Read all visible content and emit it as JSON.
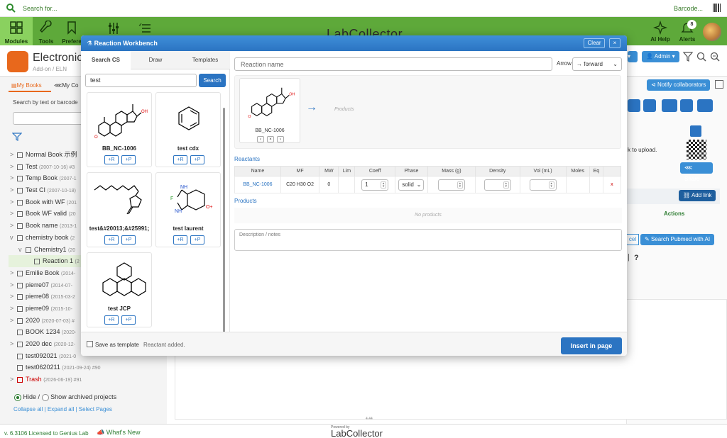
{
  "topbar": {
    "search_placeholder": "Search for...",
    "barcode_label": "Barcode..."
  },
  "nav": {
    "items": [
      {
        "label": "Modules",
        "icon": "grid-icon"
      },
      {
        "label": "Tools",
        "icon": "wrench-icon"
      },
      {
        "label": "Prefere",
        "icon": "bookmark-icon"
      }
    ],
    "logo": "LabCollector",
    "ai_help": "AI Help",
    "alerts": "Alerts",
    "alerts_count": "8"
  },
  "app": {
    "title": "Electronic",
    "subtitle": "Add-on / ELN",
    "admin": "Admin",
    "notify": "Notify collaborators",
    "upload_hint": "k to upload.",
    "share": "Share",
    "add_link": "Add link",
    "actions": "Actions",
    "cel": "cel",
    "pubmed": "Search Pubmed with AI",
    "question": "?"
  },
  "sidebar": {
    "tab_books": "My Books",
    "tab_co": "My Co",
    "search_label": "Search by text or barcode",
    "tree": [
      {
        "caret": ">",
        "name": "Normal Book 示例",
        "date": ""
      },
      {
        "caret": ">",
        "name": "Test",
        "date": "(2007-10-16) #3"
      },
      {
        "caret": ">",
        "name": "Temp Book",
        "date": "(2007-1"
      },
      {
        "caret": ">",
        "name": "Test CI",
        "date": "(2007-10-18)"
      },
      {
        "caret": ">",
        "name": "Book with WF",
        "date": "(201"
      },
      {
        "caret": ">",
        "name": "Book WF valid",
        "date": "(20"
      },
      {
        "caret": ">",
        "name": "Book name",
        "date": "(2013-1"
      },
      {
        "caret": "v",
        "name": "chemistry book",
        "date": "(2"
      },
      {
        "caret": "v",
        "name": "Chemistry1",
        "date": "(20",
        "indent": 1
      },
      {
        "caret": "",
        "name": "Reaction 1",
        "date": "(2",
        "indent": 2,
        "active": true
      },
      {
        "caret": ">",
        "name": "Emilie Book",
        "date": "(2014-"
      },
      {
        "caret": ">",
        "name": "pierre07",
        "date": "(2014-07-"
      },
      {
        "caret": ">",
        "name": "pierre08",
        "date": "(2015-03-2"
      },
      {
        "caret": ">",
        "name": "pierre09",
        "date": "(2015-10-"
      },
      {
        "caret": ">",
        "name": "2020",
        "date": "(2020-07-03) #"
      },
      {
        "caret": "",
        "name": "BOOK 1234",
        "date": "(2020-"
      },
      {
        "caret": ">",
        "name": "2020 dec",
        "date": "(2020-12-"
      },
      {
        "caret": "",
        "name": "test092021",
        "date": "(2021-0"
      },
      {
        "caret": "",
        "name": "test0620211",
        "date": "(2021-09-24) #90"
      },
      {
        "caret": ">",
        "name": "Trash",
        "date": "(2026-06-19) #91",
        "trash": true
      }
    ],
    "hide": "Hide /",
    "show_archived": "Show archived projects",
    "links": "Collapse all | Expand all | Select Pages"
  },
  "modal": {
    "title": "Reaction Workbench",
    "clear": "Clear",
    "close": "×",
    "tabs": [
      "Search CS",
      "Draw",
      "Templates"
    ],
    "search_value": "test",
    "search_btn": "Search",
    "cards": [
      {
        "name": "BB_NC-1006"
      },
      {
        "name": "test cdx"
      },
      {
        "name": "test&#20013;&#25991;"
      },
      {
        "name": "test laurent"
      },
      {
        "name": "test JCP"
      }
    ],
    "add_r": "+R",
    "add_p": "+P",
    "reaction_name_placeholder": "Reaction name",
    "arrow_label": "Arrow",
    "arrow_value": "→ forward",
    "canvas_reactant": "BB_NC-1006",
    "canvas_products": "Products",
    "reactants_title": "Reactants",
    "columns": [
      "Name",
      "MF",
      "MW",
      "Lim",
      "Coeff",
      "Phase",
      "Mass (g)",
      "Density",
      "Vol (mL)",
      "Moles",
      "Eq"
    ],
    "row": {
      "name": "BB_NC-1006",
      "mf": "C20 H30 O2",
      "mw": "0",
      "coeff": "1",
      "phase": "solid",
      "remove": "x"
    },
    "products_title": "Products",
    "no_products": "No products",
    "notes_placeholder": "Description / notes",
    "save_template": "Save as template",
    "status": "Reactant added.",
    "insert": "Insert in page"
  },
  "footer": {
    "version": "v. 6.3106 Licensed to Genius Lab",
    "whats_new": "What's New",
    "powered": "Powered by",
    "logo": "LabCollector",
    "small_num": "4.44"
  }
}
